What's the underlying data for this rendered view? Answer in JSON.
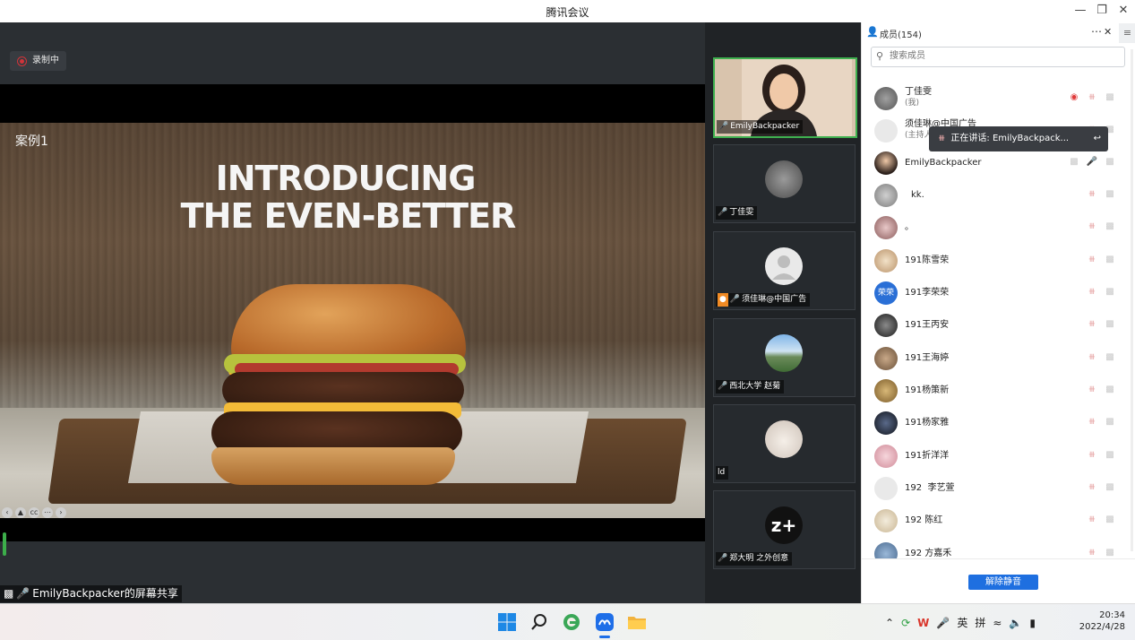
{
  "window": {
    "title": "腾讯会议"
  },
  "stage": {
    "recording_label": "录制中",
    "slide_label": "案例1",
    "slide_heading_1": "INTRODUCING",
    "slide_heading_2": "THE EVEN-BETTER",
    "share_label": "EmilyBackpacker的屏幕共享"
  },
  "video_tiles": [
    {
      "name": "EmilyBackpacker",
      "active": true
    },
    {
      "name": "丁佳雯"
    },
    {
      "name": "须佳琳@中国广告"
    },
    {
      "name": "西北大学 赵菊"
    },
    {
      "name": "ld"
    },
    {
      "name": "郑大明 之外创意",
      "avatar_text": "z+"
    }
  ],
  "panel": {
    "title": "成员(154)",
    "search_placeholder": "搜索成员",
    "speaking_label": "正在讲话: EmilyBackpack...",
    "unmute_button": "解除静音",
    "members": [
      {
        "name": "丁佳雯",
        "sub": "(我)"
      },
      {
        "name": "须佳琳@中国广告",
        "sub": "(主持人"
      },
      {
        "name": "EmilyBackpacker"
      },
      {
        "name": "kk."
      },
      {
        "name": "。"
      },
      {
        "name": "191陈雪荣"
      },
      {
        "name": "191李荣荣"
      },
      {
        "name": "191王丙安"
      },
      {
        "name": "191王海婷"
      },
      {
        "name": "191杨策新"
      },
      {
        "name": "191杨家雅"
      },
      {
        "name": "191折洋洋"
      },
      {
        "name": "192  李艺萱"
      },
      {
        "name": "192 陈红"
      },
      {
        "name": "192 方嘉禾"
      }
    ]
  },
  "taskbar": {
    "lang1": "英",
    "lang2": "拼",
    "time": "20:34",
    "date": "2022/4/28"
  }
}
